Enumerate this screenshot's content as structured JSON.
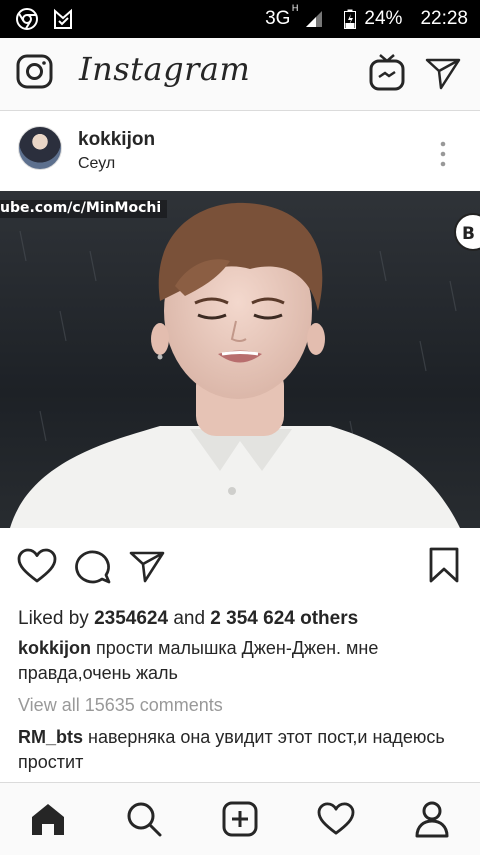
{
  "status_bar": {
    "network": "3G",
    "network_sub": "H",
    "battery": "24%",
    "time": "22:28"
  },
  "header": {
    "logo": "Instagram"
  },
  "post": {
    "username": "kokkijon",
    "location": "Сеул",
    "image": {
      "watermark": "ube.com/c/MinMochi",
      "badge_text": "B"
    },
    "likes": {
      "prefix": "Liked by",
      "first": "2354624",
      "and": "and",
      "others": "2 354 624 others"
    },
    "caption": {
      "username": "kokkijon",
      "text": "прости малышка Джен-Джен. мне правда,очень жаль"
    },
    "view_all_comments": "View all 15635 comments",
    "comments": [
      {
        "username": "RM_bts",
        "text": "наверняка она увидит этот пост,и надеюсь простит"
      }
    ]
  },
  "colors": {
    "text": "#262626",
    "muted": "#999999",
    "bar_bg": "#fafafa",
    "status_bg": "#000000"
  },
  "icons": {
    "top": [
      "camera-icon",
      "igtv-icon",
      "direct-send-icon"
    ],
    "actions": [
      "heart-icon",
      "comment-icon",
      "share-icon",
      "bookmark-icon"
    ],
    "nav": [
      "home-icon",
      "search-icon",
      "add-post-icon",
      "activity-heart-icon",
      "profile-icon"
    ]
  }
}
